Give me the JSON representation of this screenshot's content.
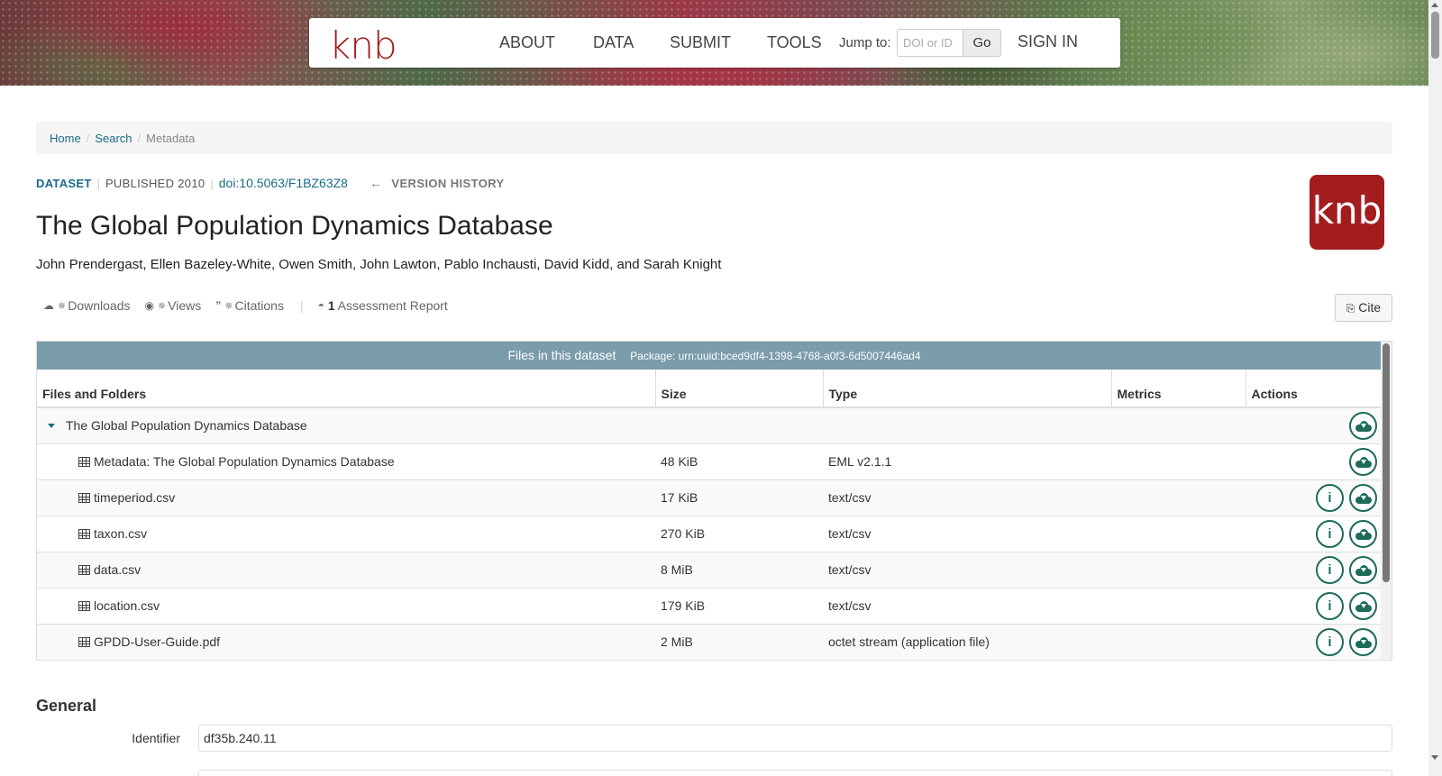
{
  "nav": {
    "logo": "knb",
    "links": [
      "ABOUT",
      "DATA",
      "SUBMIT",
      "TOOLS"
    ],
    "jump_label": "Jump to:",
    "jump_placeholder": "DOI or ID",
    "go_label": "Go",
    "sign_in": "SIGN IN"
  },
  "breadcrumb": {
    "home": "Home",
    "search": "Search",
    "current": "Metadata",
    "separator": "/"
  },
  "dataset": {
    "type_label": "DATASET",
    "published": "PUBLISHED 2010",
    "doi": "doi:10.5063/F1BZ63Z8",
    "version_history": "VERSION HISTORY",
    "title": "The Global Population Dynamics Database",
    "authors": "John Prendergast, Ellen Bazeley-White, Owen Smith, John Lawton, Pablo Inchausti, David Kidd, and Sarah Knight",
    "badge": "knb"
  },
  "metrics": {
    "downloads": "Downloads",
    "views": "Views",
    "citations": "Citations",
    "assessment_count": "1",
    "assessment_label": "Assessment Report",
    "cite": "Cite"
  },
  "files": {
    "header": "Files in this dataset",
    "package": "Package: urn:uuid:bced9df4-1398-4768-a0f3-6d5007446ad4",
    "columns": [
      "Files and Folders",
      "Size",
      "Type",
      "Metrics",
      "Actions"
    ],
    "folder": "The Global Population Dynamics Database",
    "rows": [
      {
        "name": "Metadata: The Global Population Dynamics Database",
        "size": "48 KiB",
        "type": "EML v2.1.1"
      },
      {
        "name": "timeperiod.csv",
        "size": "17 KiB",
        "type": "text/csv"
      },
      {
        "name": "taxon.csv",
        "size": "270 KiB",
        "type": "text/csv"
      },
      {
        "name": "data.csv",
        "size": "8 MiB",
        "type": "text/csv"
      },
      {
        "name": "location.csv",
        "size": "179 KiB",
        "type": "text/csv"
      },
      {
        "name": "GPDD-User-Guide.pdf",
        "size": "2 MiB",
        "type": "octet stream (application file)"
      }
    ]
  },
  "general": {
    "title": "General",
    "identifier_label": "Identifier",
    "identifier_value": "df35b.240.11"
  },
  "colors": {
    "brand": "#a31d1f",
    "link": "#1a6b8a",
    "table_header": "#7a9cab",
    "action": "#1d6b5a"
  }
}
